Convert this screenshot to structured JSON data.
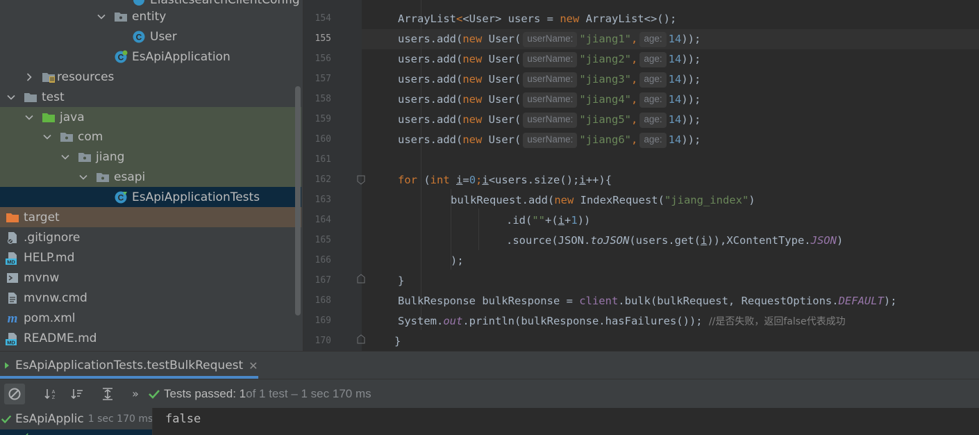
{
  "project_tree": {
    "items": [
      {
        "label": "ElasticsearchClientConfig"
      },
      {
        "label": "entity"
      },
      {
        "label": "User"
      },
      {
        "label": "EsApiApplication"
      },
      {
        "label": "resources"
      },
      {
        "label": "test"
      },
      {
        "label": "java"
      },
      {
        "label": "com"
      },
      {
        "label": "jiang"
      },
      {
        "label": "esapi"
      },
      {
        "label": "EsApiApplicationTests"
      },
      {
        "label": "target"
      },
      {
        "label": ".gitignore"
      },
      {
        "label": "HELP.md"
      },
      {
        "label": "mvnw"
      },
      {
        "label": "mvnw.cmd"
      },
      {
        "label": "pom.xml"
      },
      {
        "label": "README.md"
      }
    ]
  },
  "editor": {
    "line_numbers": [
      "154",
      "155",
      "156",
      "157",
      "158",
      "159",
      "160",
      "161",
      "162",
      "163",
      "164",
      "165",
      "166",
      "167",
      "168",
      "169",
      "170"
    ],
    "current_line": "155",
    "hints": {
      "user_name": "userName:",
      "age": "age:"
    },
    "code": {
      "l154": {
        "t1": "ArrayList",
        "t2": "<User> users = ",
        "t3": "new ",
        "t4": "ArrayList<>();"
      },
      "adds": [
        {
          "pre": "users.add(",
          "kw": "new ",
          "cls": "User(",
          "str": "\"jiang1\"",
          "comma": ",",
          "num": "14",
          "end": "));"
        },
        {
          "pre": "users.add(",
          "kw": "new ",
          "cls": "User(",
          "str": "\"jiang2\"",
          "comma": ",",
          "num": "14",
          "end": "));"
        },
        {
          "pre": "users.add(",
          "kw": "new ",
          "cls": "User(",
          "str": "\"jiang3\"",
          "comma": ",",
          "num": "14",
          "end": "));"
        },
        {
          "pre": "users.add(",
          "kw": "new ",
          "cls": "User(",
          "str": "\"jiang4\"",
          "comma": ",",
          "num": "14",
          "end": "));"
        },
        {
          "pre": "users.add(",
          "kw": "new ",
          "cls": "User(",
          "str": "\"jiang5\"",
          "comma": ",",
          "num": "14",
          "end": "));"
        },
        {
          "pre": "users.add(",
          "kw": "new ",
          "cls": "User(",
          "str": "\"jiang6\"",
          "comma": ",",
          "num": "14",
          "end": "));"
        }
      ],
      "l162": {
        "kw": "for ",
        "a": "(",
        "kw2": "int ",
        "v1": "i",
        "b": "=",
        "n0": "0",
        "c": ";",
        "v2": "i",
        "d": "<users.size();",
        "v3": "i",
        "e": "++){"
      },
      "l163": {
        "a": "bulkRequest.add(",
        "kw": "new ",
        "b": "IndexRequest(",
        "str": "\"jiang_index\"",
        "c": ")"
      },
      "l164": {
        "a": ".id(",
        "str": "\"\"",
        "b": "+(",
        "v": "i",
        "c": "+",
        "n": "1",
        "d": "))"
      },
      "l165": {
        "a": ".source(JSON.",
        "m": "toJSON",
        "b": "(users.get(",
        "v": "i",
        "c": ")),XContentType.",
        "f": "JSON",
        "d": ")"
      },
      "l166": {
        "a": ");"
      },
      "l167": {
        "a": "}"
      },
      "l168": {
        "a": "BulkResponse bulkResponse = ",
        "f": "client",
        "b": ".bulk(bulkRequest, RequestOptions.",
        "f2": "DEFAULT",
        "c": ");"
      },
      "l169": {
        "a": "System.",
        "f": "out",
        "b": ".println(bulkResponse.hasFailures()); ",
        "cm": "//是否失败，返回false代表成功"
      },
      "l170": {
        "a": "}"
      }
    }
  },
  "run_panel": {
    "tab_label": "EsApiApplicationTests.testBulkRequest",
    "tests_passed_label": "Tests passed: 1",
    "tests_detail": " of 1 test – 1 sec 170 ms",
    "tree_item_label": "EsApiApplic",
    "tree_item_time": "1 sec 170 ms",
    "console_output": "false"
  },
  "colors": {
    "editor_bg": "#2b2b2b",
    "panel_bg": "#3c3f41",
    "keyword": "#cc7832",
    "string": "#6a8759",
    "number": "#6897bb",
    "field": "#9876aa",
    "passed": "#5fb85f",
    "selection": "#0d293e",
    "tab_underline": "#4a88c7"
  }
}
